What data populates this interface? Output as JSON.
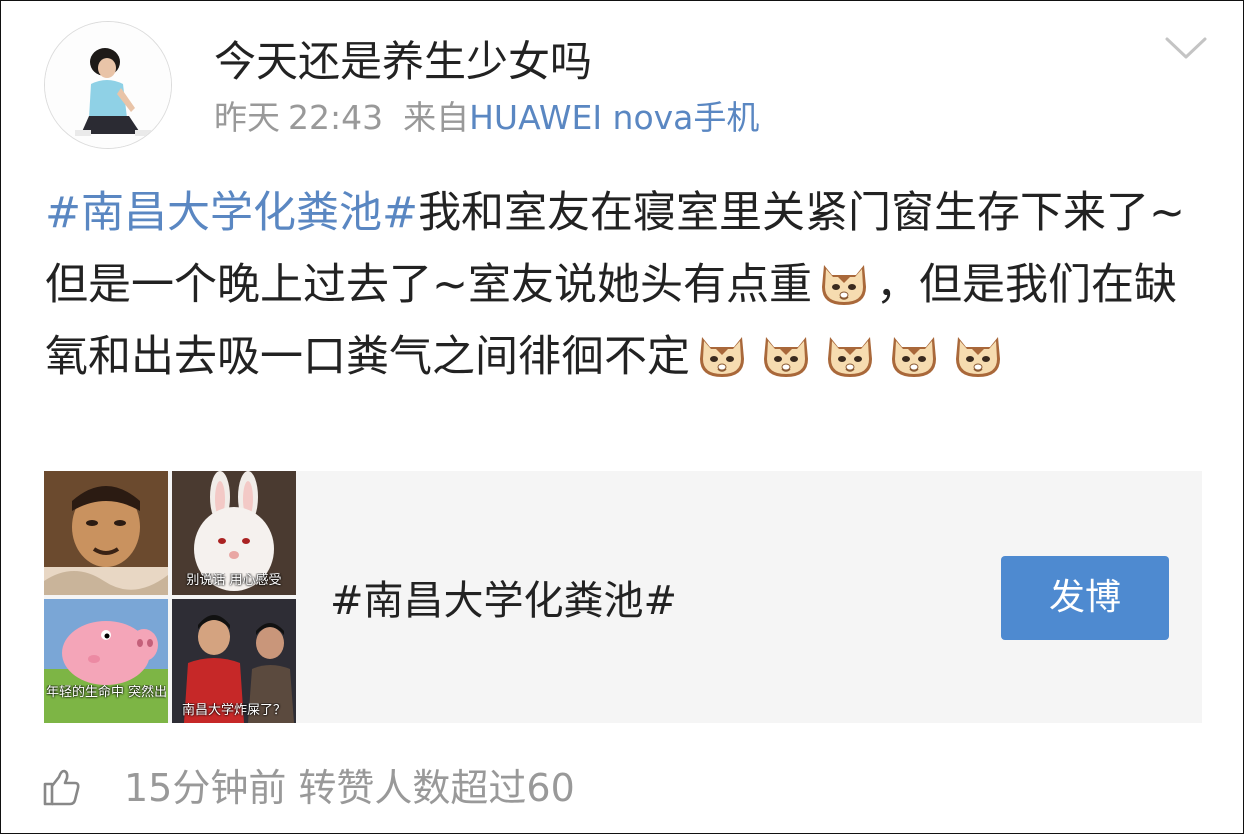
{
  "post": {
    "username": "今天还是养生少女吗",
    "date": "昨天",
    "time": "22:43",
    "source_prefix": "来自",
    "source": "HUAWEI nova手机",
    "hashtag": "#南昌大学化粪池#",
    "text_1": "我和室友在寝室里关紧门窗生存下来了~但是一个晚上过去了~室友说她头有点重",
    "text_2": "，但是我们在缺氧和出去吸一口粪气之间徘徊不定",
    "emoji_icon": "cat-face-icon"
  },
  "topic_card": {
    "title": "#南昌大学化粪池#",
    "button_label": "发博",
    "thumbnails": [
      {
        "caption": ""
      },
      {
        "caption": "别说话 用心感受"
      },
      {
        "caption": "年轻的生命中 突然出现一丝阴霾"
      },
      {
        "caption": "南昌大学炸屎了？"
      }
    ]
  },
  "footer": {
    "like_icon": "thumbs-up-icon",
    "text": "15分钟前 转赞人数超过60"
  },
  "colors": {
    "link": "#5a87c2",
    "button": "#4e8ad0",
    "muted": "#999999",
    "card_bg": "#f5f5f5"
  }
}
